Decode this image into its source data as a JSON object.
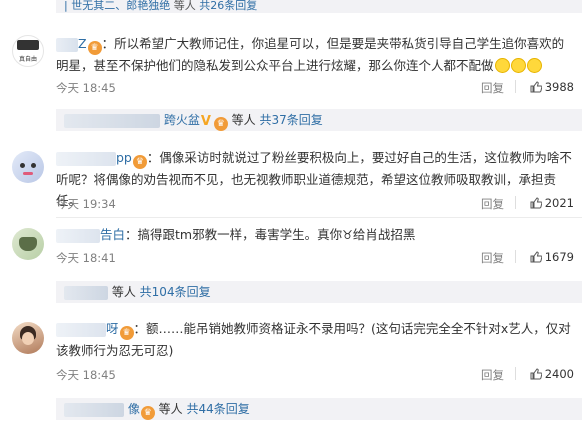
{
  "top_reply": {
    "prefix": "| 世无其二、郎艳独绝",
    "suffix": "等人",
    "count_link": "共26条回复"
  },
  "comments": [
    {
      "user_tail": "Z",
      "colon": "：",
      "text": "所以希望广大教师记住，你追星可以，但是要是夹带私货引导自己学生追你喜欢的明星，甚至不保护他们的隐私发到公众平台上进行炫耀，那么你连个人都不配做",
      "time": "今天 18:45",
      "reply_label": "回复",
      "likes": "3988",
      "avatar_caption": "真自由"
    },
    {
      "user_tail": "pp",
      "colon": "：",
      "text": "偶像采访时就说过了粉丝要积极向上，要过好自己的生活，这位教师为啥不听呢？将偶像的劝告视而不见，也无视教师职业道德规范，希望这位教师吸取教训，承担责任。",
      "time": "今天 19:34",
      "reply_label": "回复",
      "likes": "2021"
    },
    {
      "user_tail": "告白",
      "colon": "：",
      "text": "搞得跟tm邪教一样，毒害学生。真你",
      "text_after": "给肖战招黑",
      "time": "今天 18:41",
      "reply_label": "回复",
      "likes": "1679"
    },
    {
      "user_tail": "呀",
      "colon": "：",
      "text": "额……能吊销她教师资格证永不录用吗？(这句话完完全全不针对x艺人，仅对该教师行为忍无可忍)",
      "time": "今天 18:45",
      "reply_label": "回复",
      "likes": "2400"
    }
  ],
  "sub_replies": [
    {
      "user_tail": "跨火盆",
      "suffix": "等人",
      "count_link": "共37条回复"
    },
    {
      "user_tail": "",
      "suffix": "等人",
      "count_link": "共104条回复"
    },
    {
      "user_tail": "像",
      "suffix": "等人",
      "count_link": "共44条回复"
    }
  ],
  "icons": {
    "like": "thumbs-up-icon",
    "vip": "fan-badge-icon",
    "emoji": "smile-emoji-icon"
  },
  "colors": {
    "link": "#2f6ea5",
    "meta_text": "#808080",
    "reply_bg": "#f2f2f5",
    "badge_orange": "#f19b38"
  }
}
